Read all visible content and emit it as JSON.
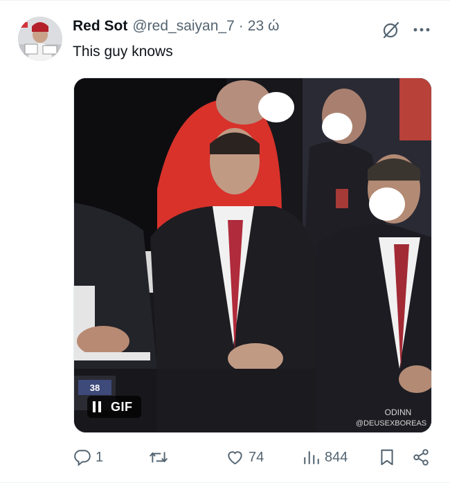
{
  "tweet": {
    "display_name": "Red Sot",
    "handle": "@red_saiyan_7",
    "separator": "·",
    "timestamp": "23 ώ",
    "text": "This guy knows",
    "more_label": "···"
  },
  "media": {
    "badge_label": "GIF",
    "overlay_score": "38",
    "watermark_line1": "ODINN",
    "watermark_line2": "@DEUSEXBOREAS"
  },
  "actions": {
    "replies": "1",
    "reposts": "",
    "likes": "74",
    "views": "844"
  },
  "colors": {
    "text_primary": "#0f1419",
    "text_secondary": "#536471",
    "divider": "#eff3f4"
  },
  "icons": [
    "avatar",
    "grok-icon",
    "more-icon",
    "pause-icon",
    "reply-icon",
    "repost-icon",
    "like-icon",
    "views-icon",
    "bookmark-icon",
    "share-icon"
  ]
}
